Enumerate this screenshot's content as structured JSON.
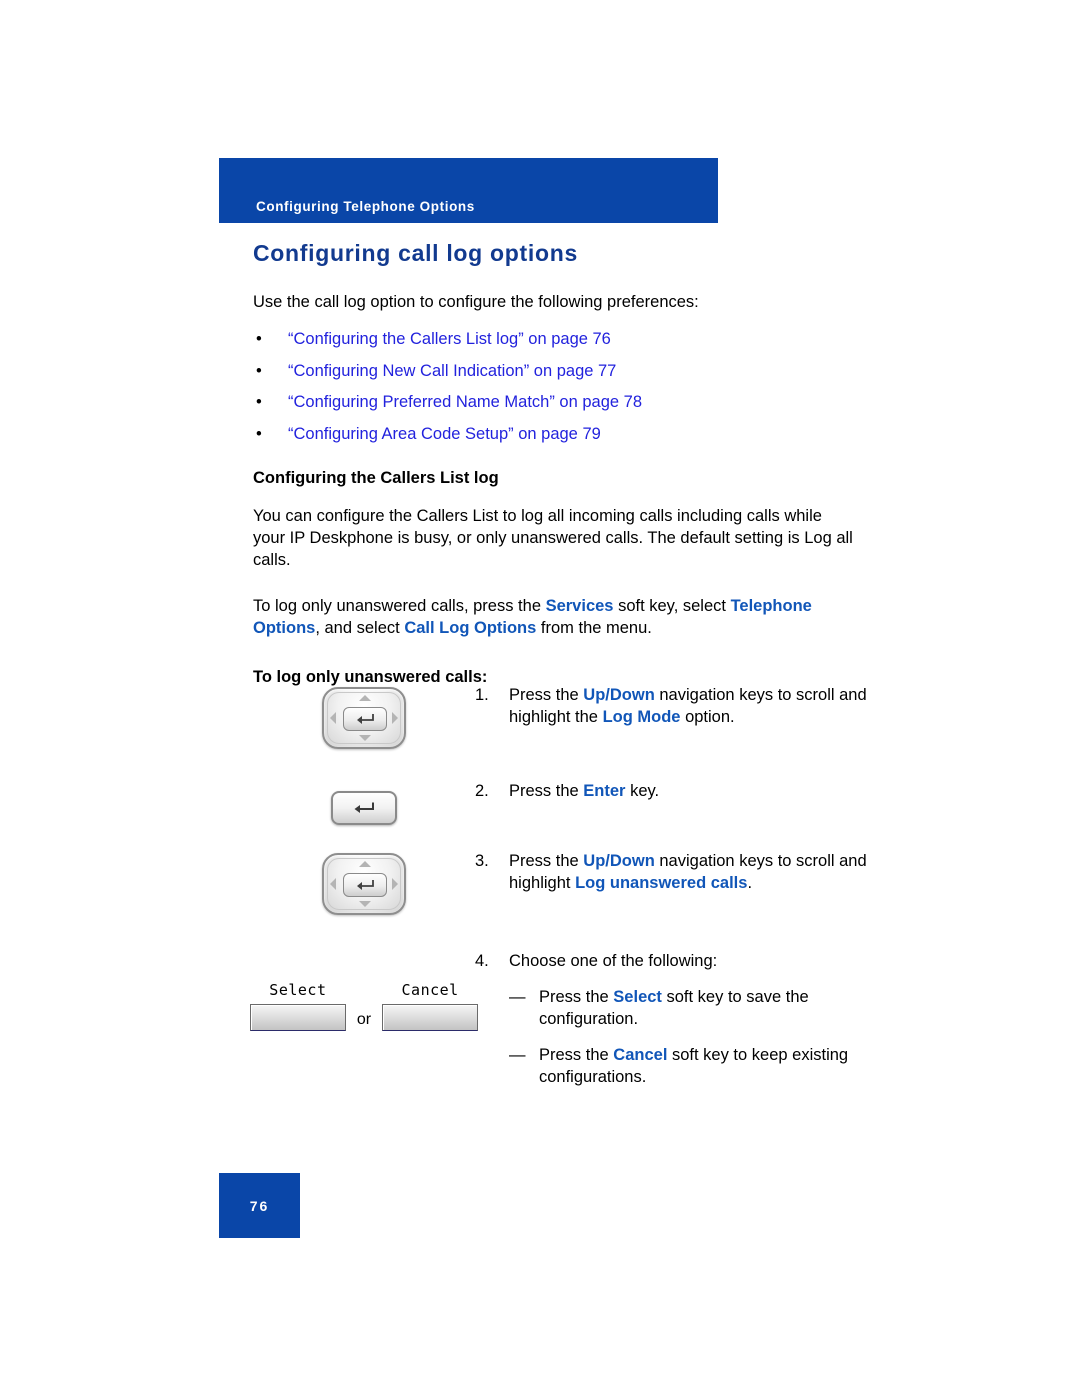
{
  "header": {
    "running_title": "Configuring Telephone Options",
    "bar_color": "#0a46a8"
  },
  "page": {
    "title": "Configuring call log options",
    "title_color": "#123a8f",
    "intro": "Use the call log option to configure the following preferences:",
    "number": "76"
  },
  "xref_list": {
    "bullet": "•",
    "link_color": "#2222dd",
    "items": [
      "“Configuring the Callers List log” on page 76",
      "“Configuring New Call Indication” on page 77",
      "“Configuring Preferred Name Match” on page 78",
      "“Configuring Area Code Setup” on page 79"
    ]
  },
  "section": {
    "heading": "Configuring the Callers List log",
    "paragraph": "You can configure the Callers List to log all incoming calls including calls while your IP Deskphone is busy, or only unanswered calls. The default setting is Log all calls.",
    "instruction": {
      "part1": "To log only unanswered calls, press the ",
      "kw1": "Services",
      "part2": " soft key, select ",
      "kw2": "Telephone Options",
      "part3": ", and select ",
      "kw3": "Call Log Options",
      "part4": " from the menu."
    },
    "procedure_heading": "To log only unanswered calls:"
  },
  "keyword_color": "#1156b8",
  "steps": [
    {
      "number": "1.",
      "art": "navigation-key",
      "text": {
        "part1": "Press the ",
        "kw1": "Up/Down",
        "part2": " navigation keys to scroll and highlight the ",
        "kw2": "Log Mode",
        "part3": " option."
      }
    },
    {
      "number": "2.",
      "art": "enter-key",
      "text": {
        "part1": "Press the ",
        "kw1": "Enter",
        "part2": " key.",
        "kw2": "",
        "part3": ""
      }
    },
    {
      "number": "3.",
      "art": "navigation-key",
      "text": {
        "part1": "Press the ",
        "kw1": "Up/Down",
        "part2": " navigation keys to scroll and highlight ",
        "kw2": "Log unanswered calls",
        "part3": "."
      }
    },
    {
      "number": "4.",
      "art": "soft-keys",
      "text": {
        "part1": "Choose one of the following:",
        "kw1": "",
        "part2": "",
        "kw2": "",
        "part3": ""
      },
      "substeps": [
        {
          "dash": "—",
          "part1": "Press the ",
          "kw1": "Select",
          "part2": " soft key to save the configuration."
        },
        {
          "dash": "—",
          "part1": "Press the ",
          "kw1": "Cancel",
          "part2": " soft key to keep existing configurations."
        }
      ]
    }
  ],
  "softkeys": {
    "select_label": "Select",
    "or_label": "or",
    "cancel_label": "Cancel"
  }
}
